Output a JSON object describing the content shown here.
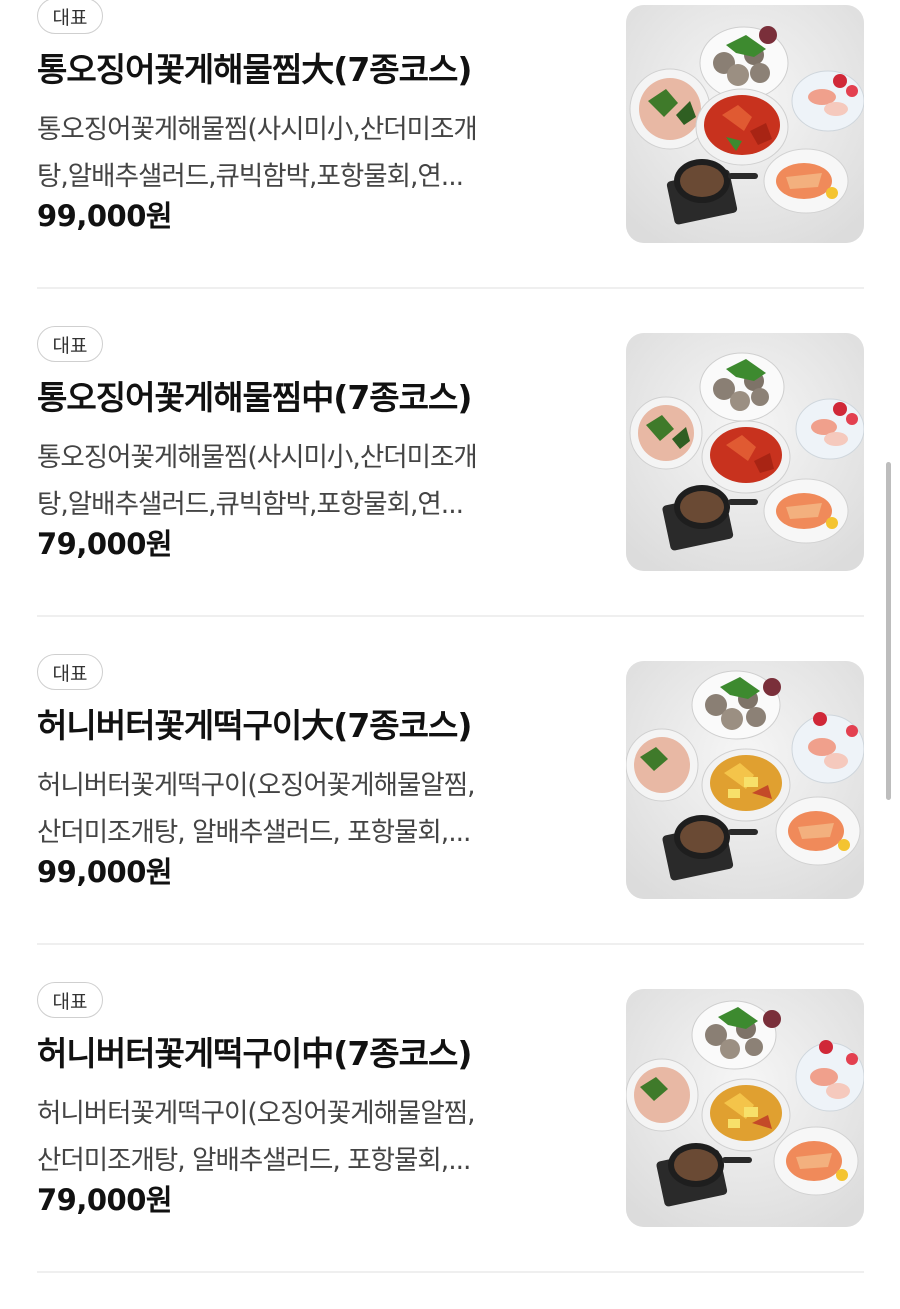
{
  "menu": {
    "items": [
      {
        "badge": "대표",
        "name": "통오징어꽃게해물찜大(7종코스)",
        "desc_line1": "통오징어꽃게해물찜(사시미小,산더미조개",
        "desc_line2": "탕,알배추샐러드,큐빅함박,포항물회,연...",
        "price": "99,000원"
      },
      {
        "badge": "대표",
        "name": "통오징어꽃게해물찜中(7종코스)",
        "desc_line1": "통오징어꽃게해물찜(사시미小,산더미조개",
        "desc_line2": "탕,알배추샐러드,큐빅함박,포항물회,연...",
        "price": "79,000원"
      },
      {
        "badge": "대표",
        "name": "허니버터꽃게떡구이大(7종코스)",
        "desc_line1": "허니버터꽃게떡구이(오징어꽃게해물알찜,",
        "desc_line2": "산더미조개탕, 알배추샐러드, 포항물회,...",
        "price": "99,000원"
      },
      {
        "badge": "대표",
        "name": "허니버터꽃게떡구이中(7종코스)",
        "desc_line1": "허니버터꽃게떡구이(오징어꽃게해물알찜,",
        "desc_line2": "산더미조개탕, 알배추샐러드, 포항물회,...",
        "price": "79,000원"
      }
    ]
  },
  "colors": {
    "badge_border": "#cfcfcf",
    "title": "#111111",
    "description": "#444444",
    "divider": "#efefef",
    "scrollbar": "#bdbdbd",
    "main_dish_steam": "#c8321e",
    "main_dish_honeybutter": "#e0a030"
  }
}
